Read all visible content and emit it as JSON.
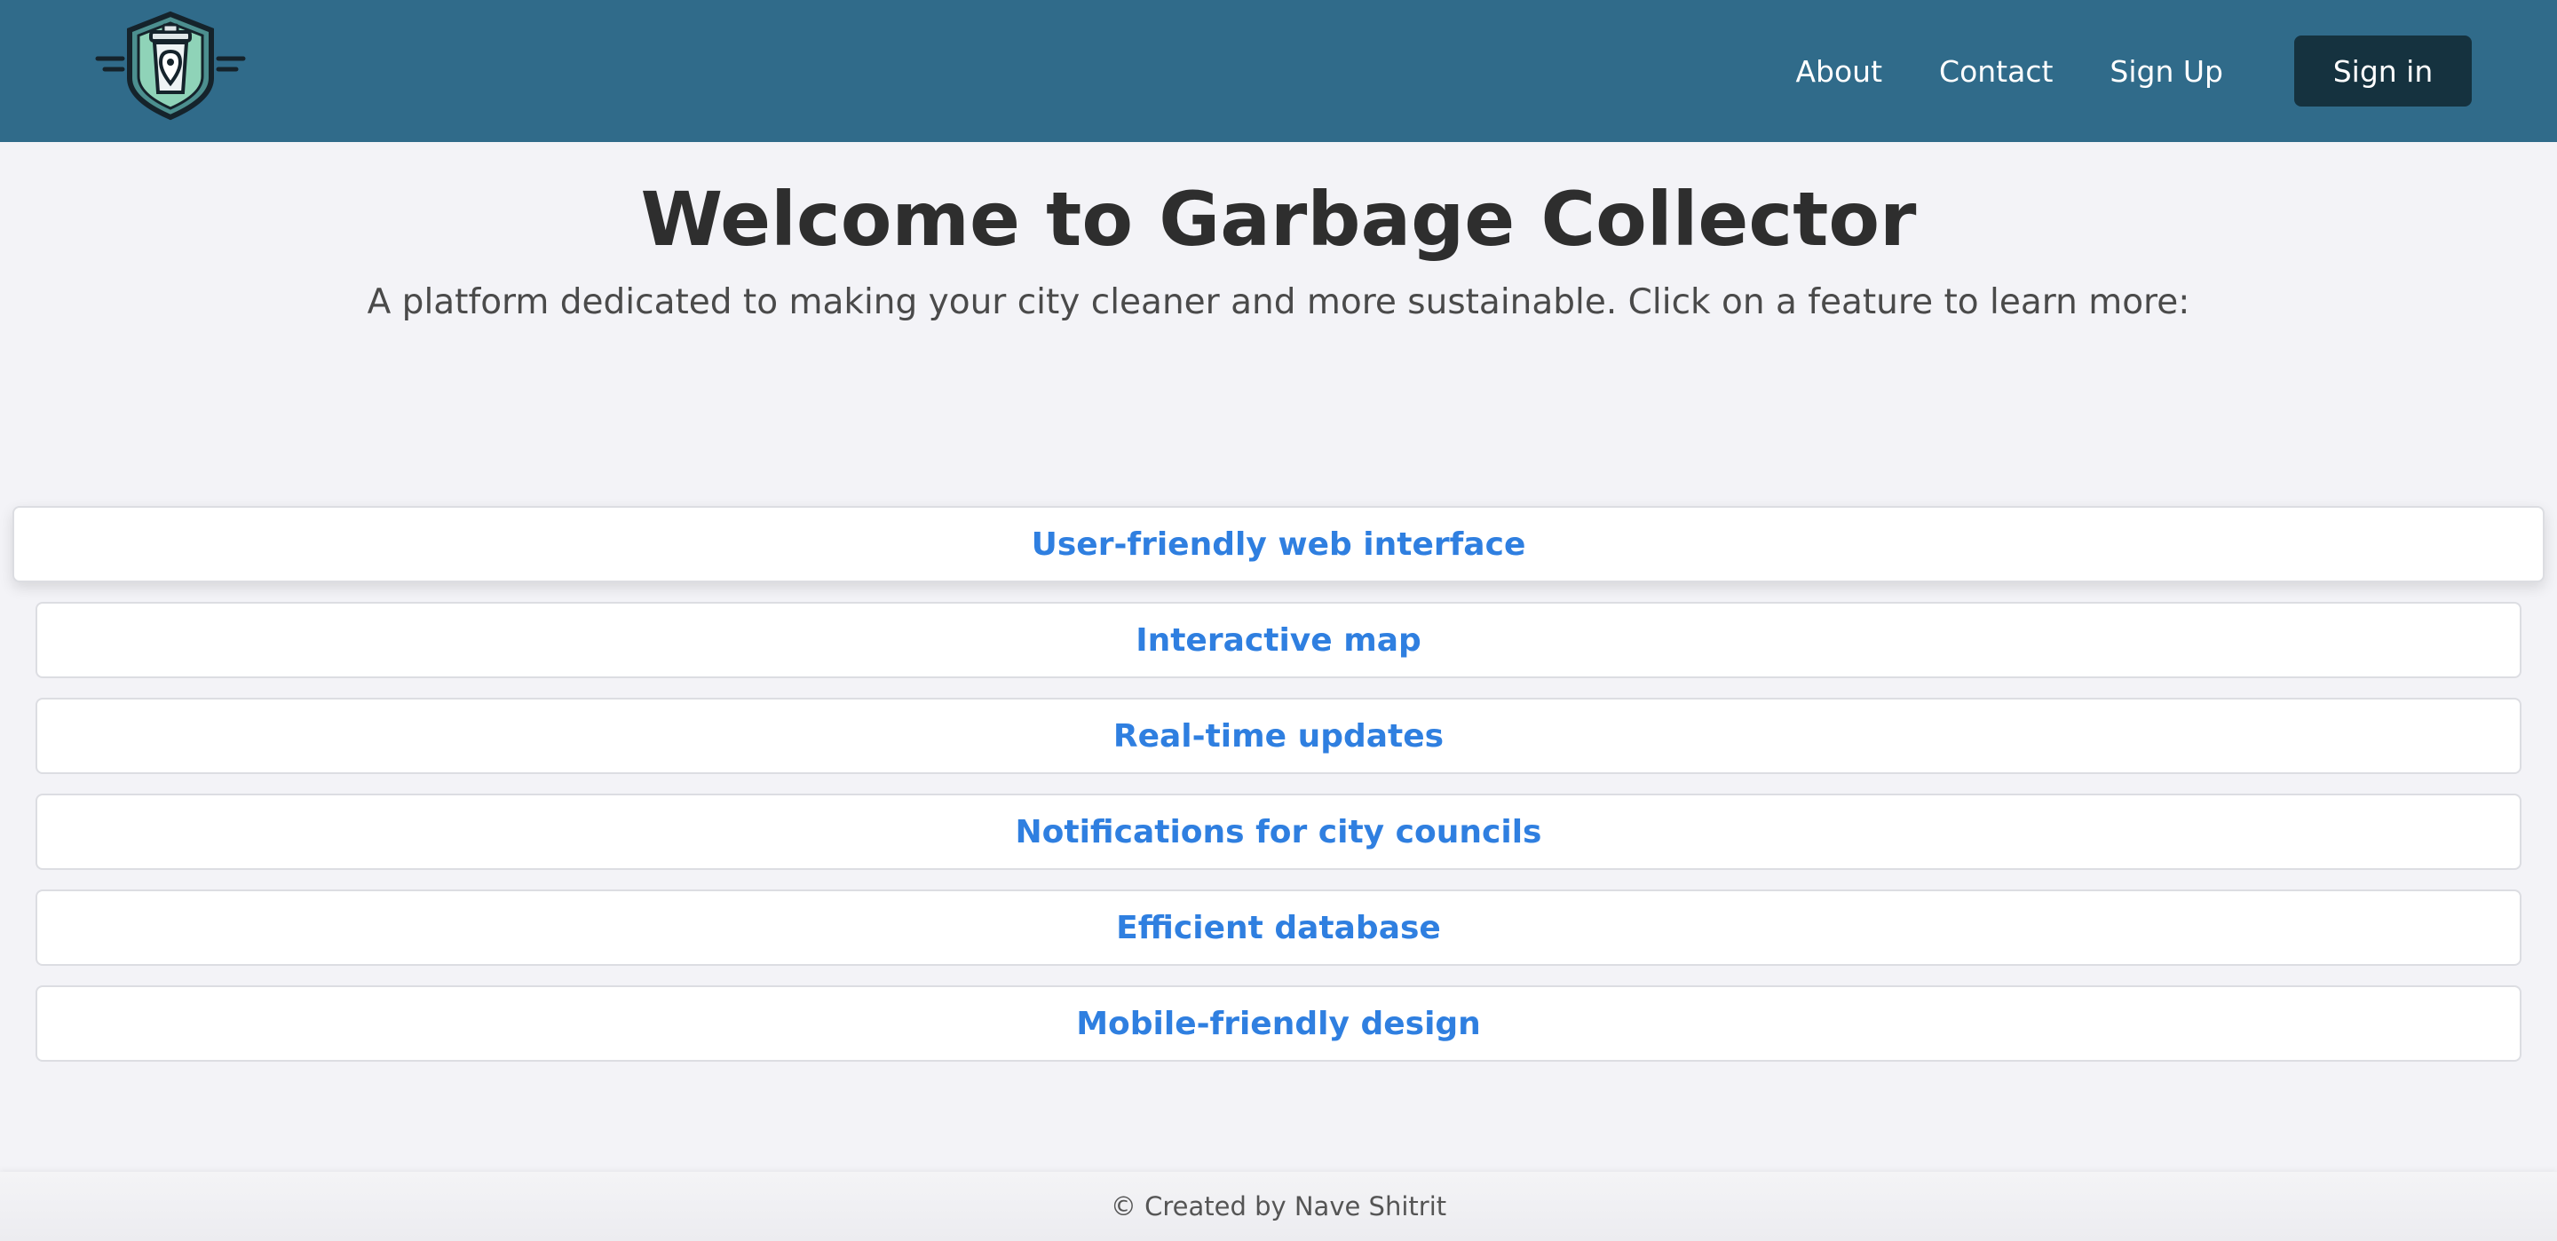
{
  "header": {
    "logo_icon": "garbage-bin-location-logo",
    "nav": {
      "about": "About",
      "contact": "Contact",
      "signup": "Sign Up",
      "signin": "Sign in"
    }
  },
  "main": {
    "title": "Welcome to Garbage Collector",
    "subtitle": "A platform dedicated to making your city cleaner and more sustainable. Click on a feature to learn more:",
    "features": [
      "User-friendly web interface",
      "Interactive map",
      "Real-time updates",
      "Notifications for city councils",
      "Efficient database",
      "Mobile-friendly design"
    ]
  },
  "footer": {
    "text": "© Created by Nave Shitrit"
  },
  "colors": {
    "header_bg": "#306b8a",
    "signin_bg": "#15323f",
    "feature_text": "#2f7fe0",
    "page_bg": "#f3f3f7"
  }
}
